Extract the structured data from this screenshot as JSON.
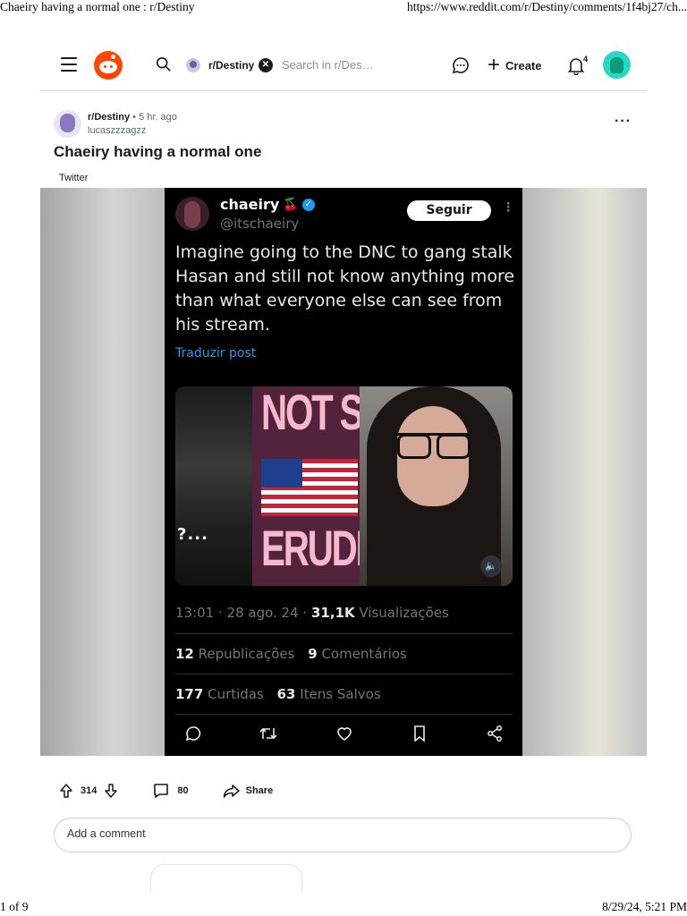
{
  "print": {
    "title": "Chaeiry having a normal one : r/Destiny",
    "url": "https://www.reddit.com/r/Destiny/comments/1f4bj27/ch...",
    "page": "1 of 9",
    "datetime": "8/29/24, 5:21 PM"
  },
  "header": {
    "subreddit": "r/Destiny",
    "search_placeholder": "Search in r/Des…",
    "create_label": "Create",
    "notification_count": "4"
  },
  "post": {
    "subreddit": "r/Destiny",
    "separator": "•",
    "time_ago": "5 hr. ago",
    "author": "lucaszzzagzz",
    "title": "Chaeiry having a normal one",
    "flair": "Twitter",
    "upvotes": "314",
    "comments": "80",
    "share_label": "Share"
  },
  "tweet": {
    "name": "chaeiry",
    "emoji": "🍒",
    "handle": "@itschaeiry",
    "follow_label": "Seguir",
    "text": "Imagine going to the DNC to gang stalk Hasan and still not know anything more than what everyone else can see from his stream.",
    "translate_label": "Traduzir post",
    "video_overlay": {
      "line1": "NOT S",
      "line2": "ERUDI",
      "left_overlay": "?..."
    },
    "timestamp": "13:01 · 28 ago. 24 ·",
    "views_count": "31,1K",
    "views_label": "Visualizações",
    "reposts_count": "12",
    "reposts_label": "Republicações",
    "comments_count": "9",
    "comments_label": "Comentários",
    "likes_count": "177",
    "likes_label": "Curtidas",
    "saves_count": "63",
    "saves_label": "Itens Salvos"
  },
  "comment_box": {
    "placeholder": "Add a comment"
  },
  "colors": {
    "reddit_orange": "#ff4500",
    "tweet_bg": "#000000",
    "link_blue": "#1d9bf0",
    "user_avatar": "#26d7c6"
  },
  "icons": [
    "menu-icon",
    "reddit-logo",
    "search-icon",
    "close-icon",
    "chat-icon",
    "plus-icon",
    "bell-icon",
    "more-icon",
    "verified-icon",
    "volume-icon",
    "reply-icon",
    "retweet-icon",
    "heart-icon",
    "bookmark-icon",
    "share-icon",
    "upvote-icon",
    "downvote-icon",
    "comment-icon"
  ]
}
